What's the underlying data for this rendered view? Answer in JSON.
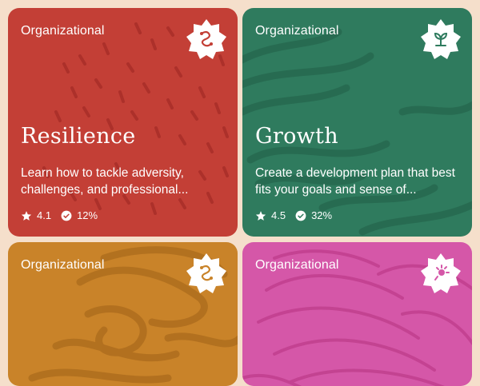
{
  "cards": [
    {
      "category": "Organizational",
      "title": "Resilience",
      "description": "Learn how to tackle adversity, challenges, and professional...",
      "rating": "4.1",
      "completion": "12%",
      "color": "#c33f36",
      "icon": "squiggle-icon"
    },
    {
      "category": "Organizational",
      "title": "Growth",
      "description": "Create a development plan that best fits your goals and sense of...",
      "rating": "4.5",
      "completion": "32%",
      "color": "#2f7b5e",
      "icon": "sprout-icon"
    },
    {
      "category": "Organizational",
      "title": "",
      "description": "",
      "rating": "",
      "completion": "",
      "color": "#c98329",
      "icon": "squiggle-icon"
    },
    {
      "category": "Organizational",
      "title": "",
      "description": "",
      "rating": "",
      "completion": "",
      "color": "#d557a8",
      "icon": "flower-icon"
    }
  ]
}
